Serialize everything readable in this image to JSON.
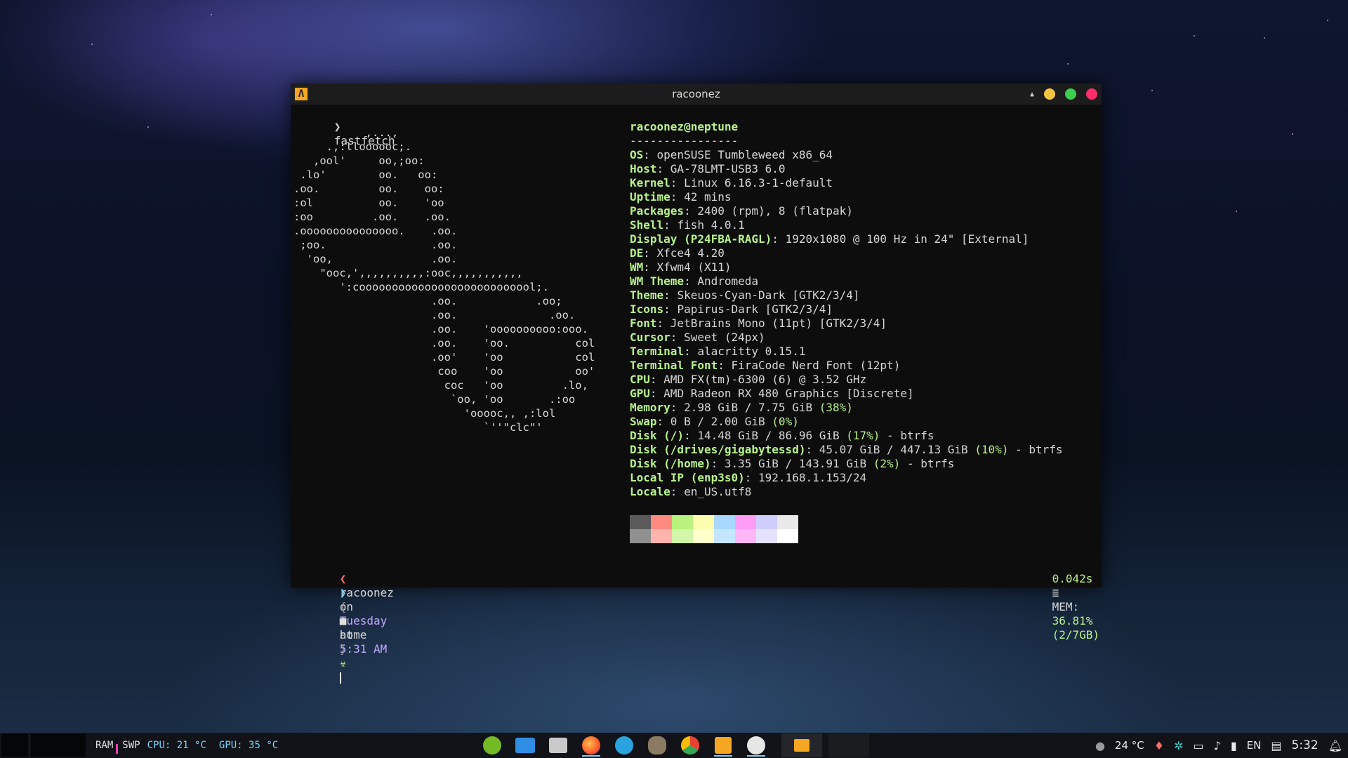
{
  "window": {
    "title": "racoonez",
    "app_icon_glyph": "Λ"
  },
  "command": {
    "prompt_glyph": "❯",
    "text": "fastfetch"
  },
  "logo_ascii": "           ,...,\n     .,:lloooooc;.\n   ,ool'     oo,;oo:\n .lo'        oo.   oo:\n.oo.         oo.    oo:\n:ol          oo.    'oo\n:oo         .oo.    .oo.\n.ooooooooooooooo.    .oo.\n ;oo.                .oo.\n  'oo,               .oo.\n    \"ooc,',,,,,,,,,,:ooc,,,,,,,,,,,\n       ':cooooooooooooooooooooooooool;.\n                     .oo.            .oo;\n                     .oo.              .oo.\n                     .oo.    'oooooooooo:ooo.\n                     .oo.    'oo.          col\n                     .oo'    'oo           col\n                      coo    'oo           oo'\n                       coc   'oo         .lo,\n                        `oo, 'oo       .:oo\n                          'ooooc,, ,:lol\n                             `''\"clc\"'",
  "userhost": "racoonez@neptune",
  "separator": "----------------",
  "info": [
    {
      "key": "OS",
      "value": "openSUSE Tumbleweed x86_64"
    },
    {
      "key": "Host",
      "value": "GA-78LMT-USB3 6.0"
    },
    {
      "key": "Kernel",
      "value": "Linux 6.16.3-1-default"
    },
    {
      "key": "Uptime",
      "value": "42 mins"
    },
    {
      "key": "Packages",
      "value": "2400 (rpm), 8 (flatpak)"
    },
    {
      "key": "Shell",
      "value": "fish 4.0.1"
    },
    {
      "key": "Display (P24FBA-RAGL)",
      "value": "1920x1080 @ 100 Hz in 24\" [External]"
    },
    {
      "key": "DE",
      "value": "Xfce4 4.20"
    },
    {
      "key": "WM",
      "value": "Xfwm4 (X11)"
    },
    {
      "key": "WM Theme",
      "value": "Andromeda"
    },
    {
      "key": "Theme",
      "value": "Skeuos-Cyan-Dark [GTK2/3/4]"
    },
    {
      "key": "Icons",
      "value": "Papirus-Dark [GTK2/3/4]"
    },
    {
      "key": "Font",
      "value": "JetBrains Mono (11pt) [GTK2/3/4]"
    },
    {
      "key": "Cursor",
      "value": "Sweet (24px)"
    },
    {
      "key": "Terminal",
      "value": "alacritty 0.15.1"
    },
    {
      "key": "Terminal Font",
      "value": "FiraCode Nerd Font (12pt)"
    },
    {
      "key": "CPU",
      "value": "AMD FX(tm)-6300 (6) @ 3.52 GHz"
    },
    {
      "key": "GPU",
      "value": "AMD Radeon RX 480 Graphics [Discrete]"
    },
    {
      "key": "Memory",
      "value": "2.98 GiB / 7.75 GiB ",
      "pct": "(38%)"
    },
    {
      "key": "Swap",
      "value": "0 B / 2.00 GiB ",
      "pct": "(0%)"
    },
    {
      "key": "Disk (/)",
      "value": "14.48 GiB / 86.96 GiB ",
      "pct": "(17%)",
      "tail": " - btrfs"
    },
    {
      "key": "Disk (/drives/gigabytessd)",
      "value": "45.07 GiB / 447.13 GiB ",
      "pct": "(10%)",
      "tail": " - btrfs"
    },
    {
      "key": "Disk (/home)",
      "value": "3.35 GiB / 143.91 GiB ",
      "pct": "(2%)",
      "tail": " - btrfs"
    },
    {
      "key": "Local IP (enp3s0)",
      "value": "192.168.1.153/24"
    },
    {
      "key": "Locale",
      "value": "en_US.utf8"
    }
  ],
  "palette": {
    "top": [
      "#5a5a5a",
      "#ff8a80",
      "#b9f27c",
      "#fdfdb0",
      "#a8d8ff",
      "#ff9cf5",
      "#cfcdfc",
      "#e9e9e9"
    ],
    "bottom": [
      "#909090",
      "#ffb3ad",
      "#d2f7a8",
      "#ffffcc",
      "#c5e6ff",
      "#ffb7f8",
      "#e4e2ff",
      "#ffffff"
    ]
  },
  "prompt": {
    "user": "racoonez",
    "on": "on",
    "day": "Tuesday",
    "at": "at",
    "time": "5:31 AM",
    "duration": "0.042s",
    "mem_label": "MEM:",
    "mem_value": "36.81%",
    "mem_detail": "(2/7GB)",
    "dir_open": "{",
    "dir": "home",
    "dir_close": "}"
  },
  "taskbar": {
    "ram_label": "RAM",
    "swp_label": "SWP",
    "cpu_temp": "CPU: 21 °C",
    "gpu_temp": "GPU: 35 °C",
    "weather": "24 °C",
    "lang": "EN",
    "clock": "5:32"
  },
  "colors": {
    "accent_green": "#b8f28a",
    "accent_cyan": "#7ad3f8",
    "btn_yellow": "#f5c542",
    "btn_green": "#3ccf4e",
    "btn_red": "#ff2d6a"
  }
}
